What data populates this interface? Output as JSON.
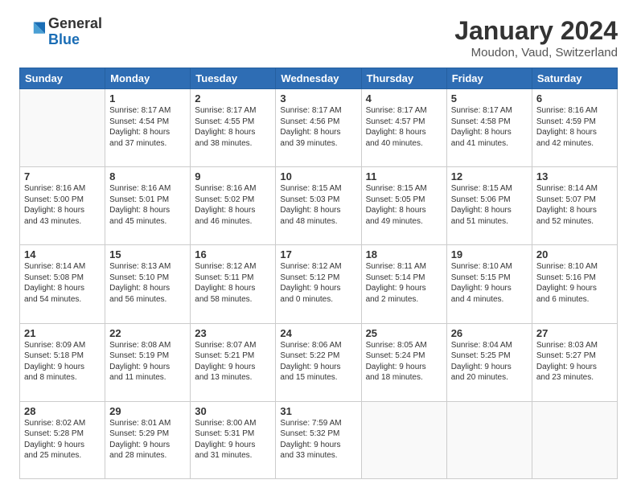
{
  "header": {
    "logo_general": "General",
    "logo_blue": "Blue",
    "title": "January 2024",
    "subtitle": "Moudon, Vaud, Switzerland"
  },
  "weekdays": [
    "Sunday",
    "Monday",
    "Tuesday",
    "Wednesday",
    "Thursday",
    "Friday",
    "Saturday"
  ],
  "weeks": [
    [
      {
        "day": "",
        "sunrise": "",
        "sunset": "",
        "daylight": ""
      },
      {
        "day": "1",
        "sunrise": "Sunrise: 8:17 AM",
        "sunset": "Sunset: 4:54 PM",
        "daylight": "Daylight: 8 hours",
        "daylight2": "and 37 minutes."
      },
      {
        "day": "2",
        "sunrise": "Sunrise: 8:17 AM",
        "sunset": "Sunset: 4:55 PM",
        "daylight": "Daylight: 8 hours",
        "daylight2": "and 38 minutes."
      },
      {
        "day": "3",
        "sunrise": "Sunrise: 8:17 AM",
        "sunset": "Sunset: 4:56 PM",
        "daylight": "Daylight: 8 hours",
        "daylight2": "and 39 minutes."
      },
      {
        "day": "4",
        "sunrise": "Sunrise: 8:17 AM",
        "sunset": "Sunset: 4:57 PM",
        "daylight": "Daylight: 8 hours",
        "daylight2": "and 40 minutes."
      },
      {
        "day": "5",
        "sunrise": "Sunrise: 8:17 AM",
        "sunset": "Sunset: 4:58 PM",
        "daylight": "Daylight: 8 hours",
        "daylight2": "and 41 minutes."
      },
      {
        "day": "6",
        "sunrise": "Sunrise: 8:16 AM",
        "sunset": "Sunset: 4:59 PM",
        "daylight": "Daylight: 8 hours",
        "daylight2": "and 42 minutes."
      }
    ],
    [
      {
        "day": "7",
        "sunrise": "Sunrise: 8:16 AM",
        "sunset": "Sunset: 5:00 PM",
        "daylight": "Daylight: 8 hours",
        "daylight2": "and 43 minutes."
      },
      {
        "day": "8",
        "sunrise": "Sunrise: 8:16 AM",
        "sunset": "Sunset: 5:01 PM",
        "daylight": "Daylight: 8 hours",
        "daylight2": "and 45 minutes."
      },
      {
        "day": "9",
        "sunrise": "Sunrise: 8:16 AM",
        "sunset": "Sunset: 5:02 PM",
        "daylight": "Daylight: 8 hours",
        "daylight2": "and 46 minutes."
      },
      {
        "day": "10",
        "sunrise": "Sunrise: 8:15 AM",
        "sunset": "Sunset: 5:03 PM",
        "daylight": "Daylight: 8 hours",
        "daylight2": "and 48 minutes."
      },
      {
        "day": "11",
        "sunrise": "Sunrise: 8:15 AM",
        "sunset": "Sunset: 5:05 PM",
        "daylight": "Daylight: 8 hours",
        "daylight2": "and 49 minutes."
      },
      {
        "day": "12",
        "sunrise": "Sunrise: 8:15 AM",
        "sunset": "Sunset: 5:06 PM",
        "daylight": "Daylight: 8 hours",
        "daylight2": "and 51 minutes."
      },
      {
        "day": "13",
        "sunrise": "Sunrise: 8:14 AM",
        "sunset": "Sunset: 5:07 PM",
        "daylight": "Daylight: 8 hours",
        "daylight2": "and 52 minutes."
      }
    ],
    [
      {
        "day": "14",
        "sunrise": "Sunrise: 8:14 AM",
        "sunset": "Sunset: 5:08 PM",
        "daylight": "Daylight: 8 hours",
        "daylight2": "and 54 minutes."
      },
      {
        "day": "15",
        "sunrise": "Sunrise: 8:13 AM",
        "sunset": "Sunset: 5:10 PM",
        "daylight": "Daylight: 8 hours",
        "daylight2": "and 56 minutes."
      },
      {
        "day": "16",
        "sunrise": "Sunrise: 8:12 AM",
        "sunset": "Sunset: 5:11 PM",
        "daylight": "Daylight: 8 hours",
        "daylight2": "and 58 minutes."
      },
      {
        "day": "17",
        "sunrise": "Sunrise: 8:12 AM",
        "sunset": "Sunset: 5:12 PM",
        "daylight": "Daylight: 9 hours",
        "daylight2": "and 0 minutes."
      },
      {
        "day": "18",
        "sunrise": "Sunrise: 8:11 AM",
        "sunset": "Sunset: 5:14 PM",
        "daylight": "Daylight: 9 hours",
        "daylight2": "and 2 minutes."
      },
      {
        "day": "19",
        "sunrise": "Sunrise: 8:10 AM",
        "sunset": "Sunset: 5:15 PM",
        "daylight": "Daylight: 9 hours",
        "daylight2": "and 4 minutes."
      },
      {
        "day": "20",
        "sunrise": "Sunrise: 8:10 AM",
        "sunset": "Sunset: 5:16 PM",
        "daylight": "Daylight: 9 hours",
        "daylight2": "and 6 minutes."
      }
    ],
    [
      {
        "day": "21",
        "sunrise": "Sunrise: 8:09 AM",
        "sunset": "Sunset: 5:18 PM",
        "daylight": "Daylight: 9 hours",
        "daylight2": "and 8 minutes."
      },
      {
        "day": "22",
        "sunrise": "Sunrise: 8:08 AM",
        "sunset": "Sunset: 5:19 PM",
        "daylight": "Daylight: 9 hours",
        "daylight2": "and 11 minutes."
      },
      {
        "day": "23",
        "sunrise": "Sunrise: 8:07 AM",
        "sunset": "Sunset: 5:21 PM",
        "daylight": "Daylight: 9 hours",
        "daylight2": "and 13 minutes."
      },
      {
        "day": "24",
        "sunrise": "Sunrise: 8:06 AM",
        "sunset": "Sunset: 5:22 PM",
        "daylight": "Daylight: 9 hours",
        "daylight2": "and 15 minutes."
      },
      {
        "day": "25",
        "sunrise": "Sunrise: 8:05 AM",
        "sunset": "Sunset: 5:24 PM",
        "daylight": "Daylight: 9 hours",
        "daylight2": "and 18 minutes."
      },
      {
        "day": "26",
        "sunrise": "Sunrise: 8:04 AM",
        "sunset": "Sunset: 5:25 PM",
        "daylight": "Daylight: 9 hours",
        "daylight2": "and 20 minutes."
      },
      {
        "day": "27",
        "sunrise": "Sunrise: 8:03 AM",
        "sunset": "Sunset: 5:27 PM",
        "daylight": "Daylight: 9 hours",
        "daylight2": "and 23 minutes."
      }
    ],
    [
      {
        "day": "28",
        "sunrise": "Sunrise: 8:02 AM",
        "sunset": "Sunset: 5:28 PM",
        "daylight": "Daylight: 9 hours",
        "daylight2": "and 25 minutes."
      },
      {
        "day": "29",
        "sunrise": "Sunrise: 8:01 AM",
        "sunset": "Sunset: 5:29 PM",
        "daylight": "Daylight: 9 hours",
        "daylight2": "and 28 minutes."
      },
      {
        "day": "30",
        "sunrise": "Sunrise: 8:00 AM",
        "sunset": "Sunset: 5:31 PM",
        "daylight": "Daylight: 9 hours",
        "daylight2": "and 31 minutes."
      },
      {
        "day": "31",
        "sunrise": "Sunrise: 7:59 AM",
        "sunset": "Sunset: 5:32 PM",
        "daylight": "Daylight: 9 hours",
        "daylight2": "and 33 minutes."
      },
      {
        "day": "",
        "sunrise": "",
        "sunset": "",
        "daylight": "",
        "daylight2": ""
      },
      {
        "day": "",
        "sunrise": "",
        "sunset": "",
        "daylight": "",
        "daylight2": ""
      },
      {
        "day": "",
        "sunrise": "",
        "sunset": "",
        "daylight": "",
        "daylight2": ""
      }
    ]
  ]
}
